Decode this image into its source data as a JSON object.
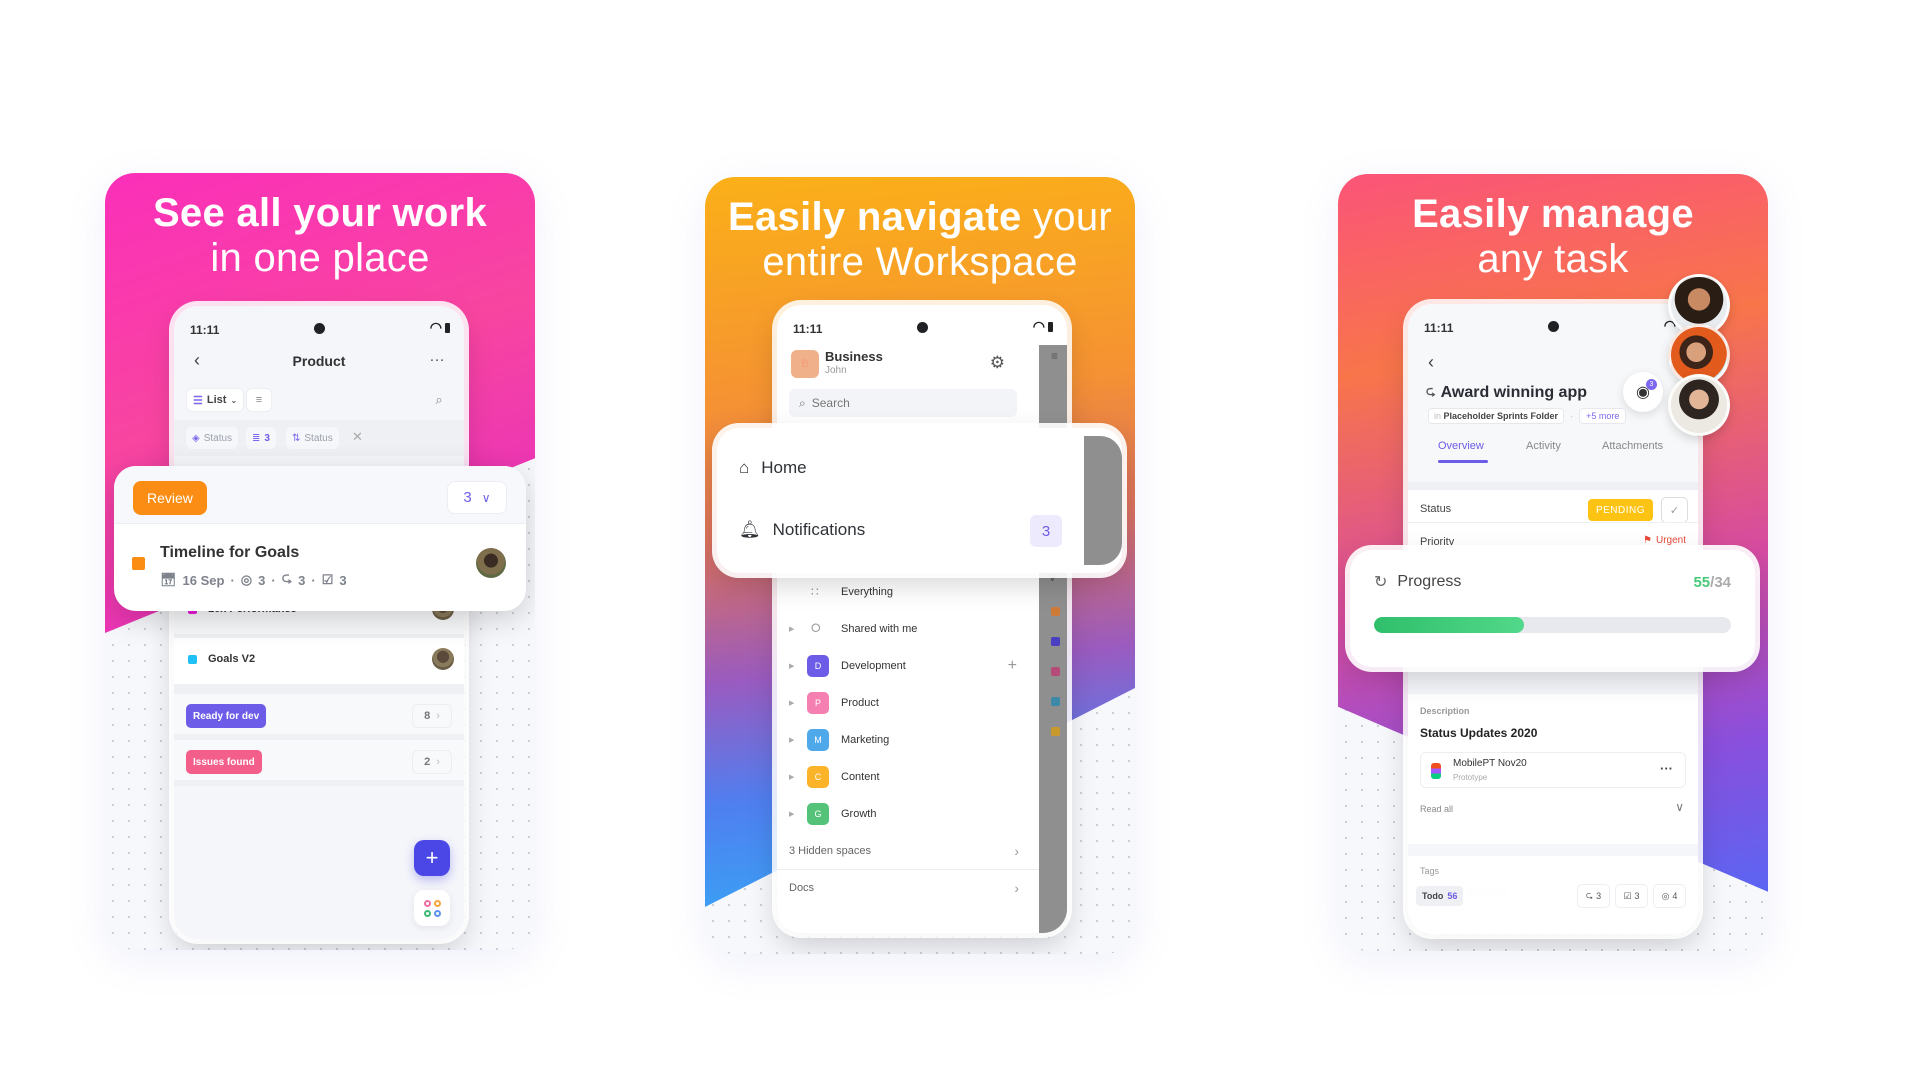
{
  "panels": [
    {
      "headline_bold": "See all your work",
      "headline_light": "in one place",
      "phone": {
        "time": "11:11",
        "title": "Product",
        "view_label": "List",
        "filters": [
          "Status",
          "3",
          "Status"
        ],
        "review_card": {
          "status_label": "Review",
          "count": "3",
          "task_name": "Timeline for Goals",
          "date": "16 Sep",
          "comments": "3",
          "subtasks": "3",
          "checklists": "3"
        },
        "tasks": [
          {
            "name": "10x Performance",
            "color": "#e81ad6"
          },
          {
            "name": "Goals V2",
            "color": "#1fc0f5"
          }
        ],
        "groups": [
          {
            "label": "Ready for dev",
            "count": "8",
            "color": "#6c5ce7"
          },
          {
            "label": "Issues found",
            "count": "2",
            "color": "#f35e8b"
          }
        ]
      }
    },
    {
      "headline_bold": "Easily navigate",
      "headline_light_inline": "your",
      "headline_light": "entire Workspace",
      "phone": {
        "time": "11:11",
        "workspace_initial": "B",
        "workspace_name": "Business",
        "workspace_user": "John",
        "search_placeholder": "Search",
        "nav_card": [
          {
            "label": "Home",
            "icon": "home-icon"
          },
          {
            "label": "Notifications",
            "icon": "bell-icon",
            "badge": "3"
          }
        ],
        "items": [
          {
            "label": "Everything",
            "icon": "grid-icon"
          },
          {
            "label": "Shared with me",
            "icon": "share-icon"
          }
        ],
        "spaces": [
          {
            "initial": "D",
            "label": "Development",
            "color": "#6c5ce7"
          },
          {
            "initial": "P",
            "label": "Product",
            "color": "#f47fb0"
          },
          {
            "initial": "M",
            "label": "Marketing",
            "color": "#4fa8ea"
          },
          {
            "initial": "C",
            "label": "Content",
            "color": "#fbb42a"
          },
          {
            "initial": "G",
            "label": "Growth",
            "color": "#55c27a"
          }
        ],
        "hidden_spaces": "3 Hidden spaces",
        "docs": "Docs"
      }
    },
    {
      "headline_bold": "Easily manage",
      "headline_light": "any task",
      "phone": {
        "time": "11:11",
        "watchers_count": "3",
        "task_name": "Award winning app",
        "location_prefix": "in",
        "location": "Placeholder Sprints Folder",
        "more_locations": "+5 more",
        "tabs": [
          "Overview",
          "Activity",
          "Attachments"
        ],
        "active_tab": "Overview",
        "status_label": "Status",
        "status_value": "PENDING",
        "priority_label": "Priority",
        "priority_value": "Urgent",
        "progress": {
          "label": "Progress",
          "done": "55",
          "total": "34",
          "fill_fraction": 0.42
        },
        "description_label": "Description",
        "description_title": "Status Updates 2020",
        "attachment_name": "MobilePT Nov20",
        "attachment_type": "Prototype",
        "read_all": "Read all",
        "tags_label": "Tags",
        "todo_label": "Todo",
        "todo_count": "56",
        "subtasks": "3",
        "checklists": "3",
        "comments": "4"
      }
    }
  ]
}
